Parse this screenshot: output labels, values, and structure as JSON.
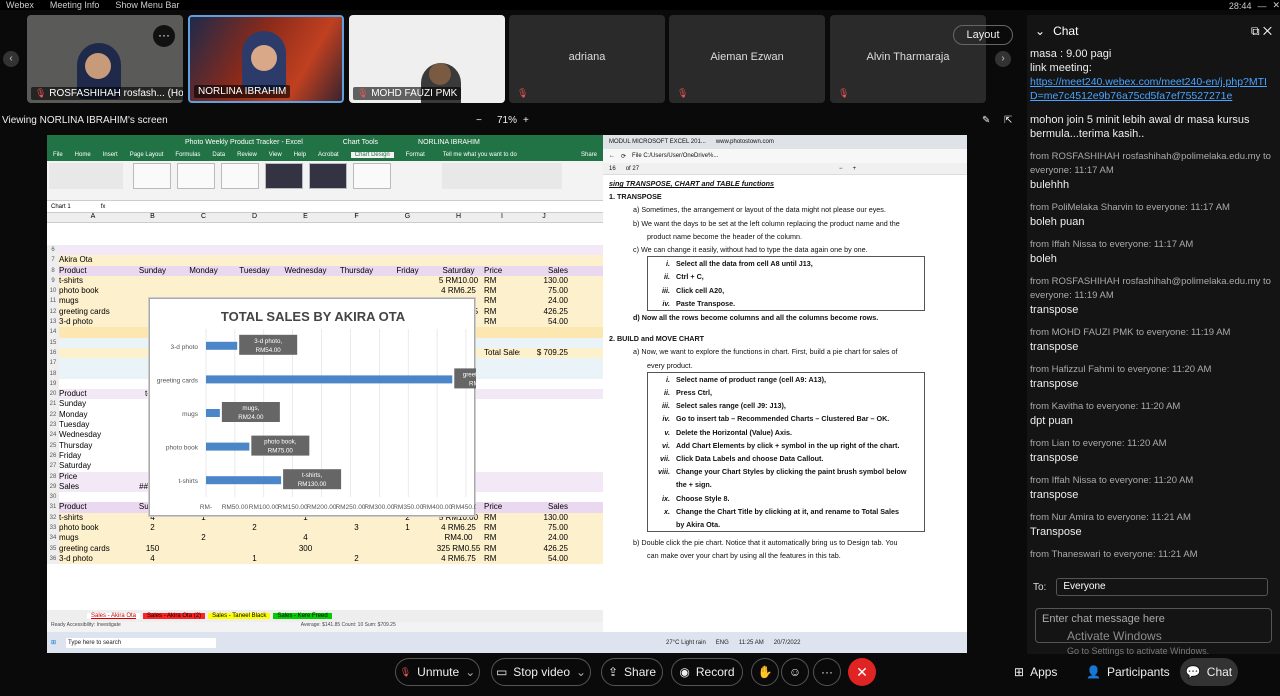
{
  "topbar": {
    "app": "Webex",
    "meeting_info": "Meeting Info",
    "menu_bar": "Show Menu Bar",
    "time": "28:44"
  },
  "tiles": [
    {
      "label": "ROSFASHIHAH rosfash... (Host...)",
      "name": ""
    },
    {
      "label": "NORLINA IBRAHIM",
      "name": ""
    },
    {
      "label": "MOHD FAUZI PMK",
      "name": ""
    },
    {
      "label": "",
      "name": "adriana"
    },
    {
      "label": "",
      "name": "Aieman Ezwan"
    },
    {
      "label": "",
      "name": "Alvin Tharmaraja"
    }
  ],
  "layout_label": "Layout",
  "viewing": "Viewing NORLINA IBRAHIM's screen",
  "zoom": "71%",
  "excel": {
    "title": "Photo Weekly Product Tracker - Excel",
    "chart_tools": "Chart Tools",
    "user": "NORLINA IBRAHIM",
    "tabs": [
      "File",
      "Home",
      "Insert",
      "Page Layout",
      "Formulas",
      "Data",
      "Review",
      "View",
      "Help",
      "Acrobat",
      "Chart Design",
      "Format"
    ],
    "tellme": "Tell me what you want to do",
    "share": "Share",
    "namebox": "Chart 1",
    "cols": [
      "A",
      "B",
      "C",
      "D",
      "E",
      "F",
      "G",
      "H",
      "I",
      "J"
    ],
    "title_cell": "Akira Ota",
    "header": [
      "Product",
      "Sunday",
      "Monday",
      "Tuesday",
      "Wednesday",
      "Thursday",
      "Friday",
      "Saturday",
      "Price",
      "Sales"
    ],
    "products": [
      "t-shirts",
      "photo book",
      "mugs",
      "greeting cards",
      "3-d photo"
    ],
    "visible_rows": [
      [
        "RM10.00",
        "RM",
        "130.00",
        "5"
      ],
      [
        "RM6.25",
        "RM",
        "75.00",
        "4"
      ],
      [
        "RM4.00",
        "RM",
        "24.00",
        ""
      ],
      [
        "RM0.55",
        "RM",
        "426.25",
        "25"
      ],
      [
        "RM6.75",
        "RM",
        "54.00",
        "4"
      ]
    ],
    "total_label": "Total Sales",
    "total_value": "$ 709.25",
    "transpose_labels": [
      "Product",
      "Sunday",
      "Monday",
      "Tuesday",
      "Wednesday",
      "Thursday",
      "Friday",
      "Saturday",
      "Price",
      "Sales"
    ],
    "product_short": "t-shi",
    "price_short": "RI",
    "row29": [
      "######",
      "RM 75.00",
      "RM 24.00",
      "######",
      "RM 54.00"
    ],
    "table2": [
      [
        "t-shirts",
        "4",
        "1",
        "",
        "1",
        "",
        "2",
        "5",
        "RM10.00",
        "RM",
        "130.00"
      ],
      [
        "photo book",
        "2",
        "",
        "2",
        "",
        "3",
        "1",
        "4",
        "RM6.25",
        "RM",
        "75.00"
      ],
      [
        "mugs",
        "",
        "2",
        "",
        "4",
        "",
        "",
        "",
        "RM4.00",
        "RM",
        "24.00"
      ],
      [
        "greeting cards",
        "150",
        "",
        "",
        "300",
        "",
        "",
        "325",
        "RM0.55",
        "RM",
        "426.25"
      ],
      [
        "3-d photo",
        "4",
        "",
        "1",
        "",
        "2",
        "",
        "4",
        "RM6.75",
        "RM",
        "54.00"
      ]
    ],
    "row_nums": [
      "6",
      "7",
      "8",
      "9",
      "10",
      "11",
      "12",
      "13",
      "14",
      "15",
      "16",
      "17",
      "18",
      "19",
      "20",
      "21",
      "22",
      "23",
      "24",
      "25",
      "26",
      "27",
      "28",
      "29",
      "30",
      "31",
      "32",
      "33",
      "34",
      "35",
      "36"
    ],
    "sheet_tabs": [
      "Sales - Akira Ota",
      "Sales - Akira Ota (2)",
      "Sales - Taneel Black",
      "Sales - Kere Freed"
    ],
    "status": "Ready   Accessibility: Investigate",
    "status_right": "Average: $141.85   Count: 10   Sum: $709.25"
  },
  "chart_data": {
    "type": "bar",
    "title": "TOTAL SALES BY AKIRA OTA",
    "categories": [
      "3-d photo",
      "greeting cards",
      "mugs",
      "photo book",
      "t-shirts"
    ],
    "values": [
      54,
      426.25,
      24,
      75,
      130
    ],
    "data_labels": [
      "3-d photo, RM54.00",
      "greeting cards, RM426.25",
      "mugs, RM24.00",
      "photo book, RM75.00",
      "t-shirts, RM130.00"
    ],
    "xticks": [
      "RM-",
      "RM50.00",
      "RM100.00",
      "RM150.00",
      "RM200.00",
      "RM250.00",
      "RM300.00",
      "RM350.00",
      "RM400.00",
      "RM450.00"
    ],
    "xlim": [
      0,
      450
    ],
    "grid": true,
    "bar_color": "#4a86c8"
  },
  "pdf": {
    "tab": "MODUL MICROSOFT EXCEL 201...",
    "tab2": "www.photostown.com",
    "addr": "File  C:/Users/User/OneDrive%...",
    "page": "16",
    "of": "of 27",
    "heading": "sing TRANSPOSE, CHART and TABLE functions",
    "s1": "1.  TRANSPOSE",
    "a": "a)  Sometimes, the arrangement or layout of the data might not please our eyes.",
    "b1": "b)  We want the days to be set at the left column replacing the product name and the",
    "b2": "product name become the header of the column.",
    "c": "c)  We can change it easily, without had to type the data again one by one.",
    "t_steps": [
      [
        "i.",
        "Select all the data from cell A8 until J13,"
      ],
      [
        "ii.",
        "Ctrl + C,"
      ],
      [
        "iii.",
        "Click cell A20,"
      ],
      [
        "iv.",
        "Paste Transpose."
      ]
    ],
    "d": "d)  Now all the rows become columns and all the columns become rows.",
    "s2": "2.  BUILD and MOVE CHART",
    "a2a": "a)  Now, we want to explore the functions in chart. First, build a pie chart for sales of",
    "a2b": "every product.",
    "c_steps": [
      [
        "i.",
        "Select name of product range (cell A9: A13),"
      ],
      [
        "ii.",
        "Press Ctrl,"
      ],
      [
        "iii.",
        "Select sales range (cell J9: J13),"
      ],
      [
        "iv.",
        "Go to insert tab – Recommended Charts – Clustered Bar – OK."
      ],
      [
        "v.",
        "Delete the Horizontal (Value) Axis."
      ],
      [
        "vi.",
        "Add Chart Elements by click + symbol in the up right of the chart."
      ],
      [
        "vii.",
        "Click Data Labels and choose Data Callout."
      ],
      [
        "viii.",
        "Change your Chart Styles by clicking the paint brush symbol below"
      ],
      [
        "",
        "the + sign."
      ],
      [
        "ix.",
        "Choose Style 8."
      ],
      [
        "x.",
        "Change the Chart Title by clicking at it, and rename to Total Sales"
      ],
      [
        "",
        "by Akira Ota."
      ]
    ],
    "b2a": "b)  Double click the pie chart. Notice that it automatically bring us to Design tab. You",
    "b2b": "can make over your chart by using all the features in this tab."
  },
  "taskbar": {
    "search": "Type here to search",
    "weather": "27°C  Light rain",
    "lang": "ENG",
    "time": "11:25 AM",
    "date": "20/7/2022"
  },
  "chat": {
    "title": "Chat",
    "messages": [
      {
        "from": "",
        "text": "masa : 9.00 pagi"
      },
      {
        "from": "",
        "text": "link meeting:"
      },
      {
        "from": "",
        "link": "https://meet240.webex.com/meet240-en/j.php?MTID=me7c4512e9b76a75cd5fa7ef75527271e"
      },
      {
        "from": "",
        "text": "mohon join 5 minit lebih awal dr masa kursus bermula...terima kasih.."
      },
      {
        "from": "from ROSFASHIHAH rosfashihah@polimelaka.edu.my to everyone:   11:17 AM",
        "text": "bulehhh"
      },
      {
        "from": "from PoliMelaka Sharvin to everyone:   11:17 AM",
        "text": "boleh puan"
      },
      {
        "from": "from Iffah Nissa to everyone:   11:17 AM",
        "text": "boleh"
      },
      {
        "from": "from ROSFASHIHAH rosfashihah@polimelaka.edu.my to everyone:   11:19 AM",
        "text": "transpose"
      },
      {
        "from": "from MOHD FAUZI PMK to everyone:   11:19 AM",
        "text": "transpose"
      },
      {
        "from": "from Hafizzul Fahmi  to everyone:   11:20 AM",
        "text": "transpose"
      },
      {
        "from": "from Kavitha to everyone:   11:20 AM",
        "text": "dpt puan"
      },
      {
        "from": "from Lian to everyone:   11:20 AM",
        "text": "transpose"
      },
      {
        "from": "from Iffah Nissa to everyone:   11:20 AM",
        "text": "transpose"
      },
      {
        "from": "from Nur Amira to everyone:   11:21 AM",
        "text": "Transpose"
      },
      {
        "from": "from Thaneswari to everyone:   11:21 AM",
        "text": ""
      }
    ],
    "to_label": "To:",
    "to_value": "Everyone",
    "placeholder": "Enter chat message here",
    "activate1": "Activate Windows",
    "activate2": "Go to Settings to activate Windows."
  },
  "controls": {
    "unmute": "Unmute",
    "stop_video": "Stop video",
    "share": "Share",
    "record": "Record",
    "apps": "Apps",
    "participants": "Participants",
    "chat": "Chat"
  }
}
